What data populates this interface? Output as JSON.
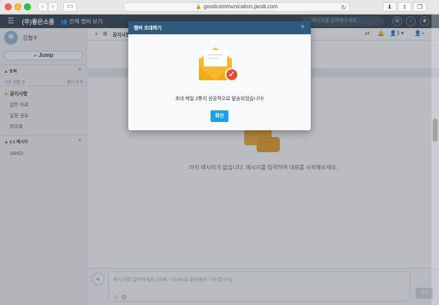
{
  "browser": {
    "url": "goodcommunication.jandi.com",
    "back_glyph": "‹",
    "forward_glyph": "›"
  },
  "header": {
    "team_name": "(주)좋은소통",
    "all_members_label": "전체 멤버 보기",
    "search_placeholder": "메시지를 입력해주세요.."
  },
  "sidebar": {
    "user_name": "김철수",
    "jump_label": "Jump",
    "topics_title": "토픽",
    "sort_label": "기본 정렬 순",
    "folder_add_label": "폴더 추가",
    "topics": [
      {
        "label": "공지사항",
        "active": true
      },
      {
        "label": "업무 자료"
      },
      {
        "label": "일정 공유"
      },
      {
        "label": "회의록"
      }
    ],
    "dm_title": "1:1 메시지",
    "dm_items": [
      {
        "label": "JANDI"
      }
    ]
  },
  "main": {
    "topic_name": "공지사항",
    "member_count": "3",
    "empty_message": "아직 메시지가 없습니다. 메시지를 입력하여 대화를 시작해보세요.",
    "composer_placeholder": "메시지를 입력하세요 (Shift + Enter로 줄바꿈이 가능합니다)",
    "send_label": "전송"
  },
  "modal": {
    "title": "멤버 초대하기",
    "message": "초대 메일 2통이 성공적으로 발송되었습니다!",
    "confirm_label": "확인"
  },
  "colors": {
    "header": "#2a3847",
    "modal_header": "#2f5a7d",
    "confirm": "#1aa1e6",
    "envelope": "#f5b82e",
    "badge": "#ec4b35"
  }
}
